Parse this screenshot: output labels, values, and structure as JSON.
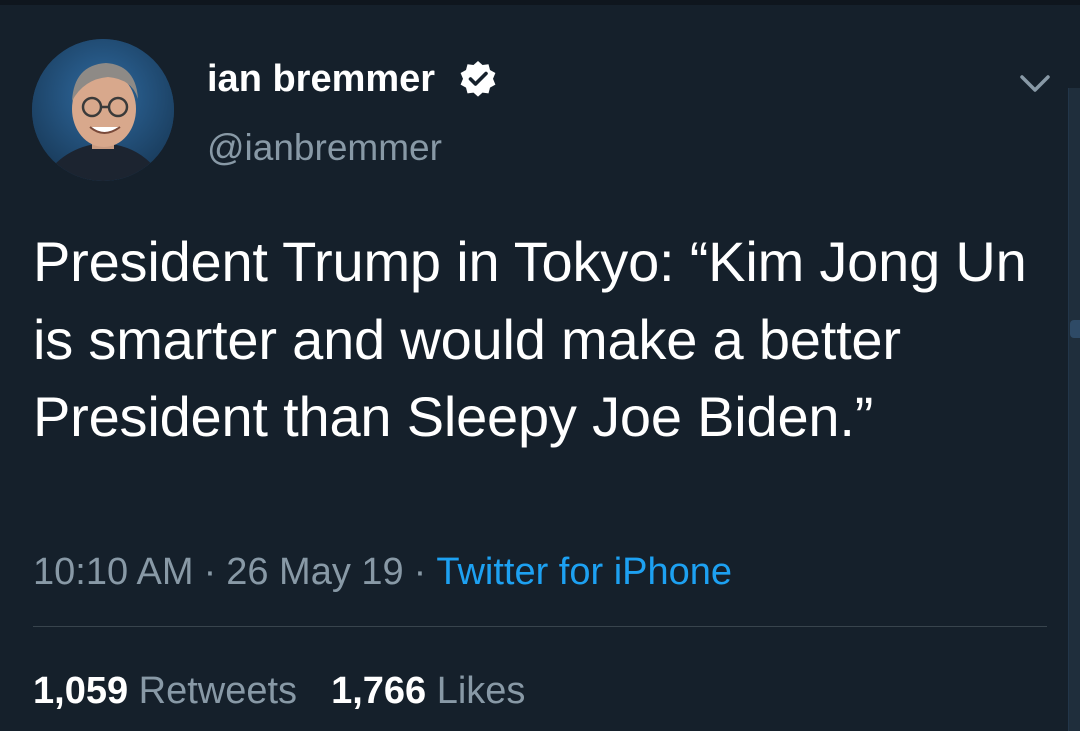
{
  "user": {
    "display_name": "ian bremmer",
    "handle": "@ianbremmer",
    "verified": true,
    "avatar_icon": "profile-photo"
  },
  "tweet": {
    "text": "President Trump in Tokyo: “Kim Jong Un is smarter and would make a better President than Sleepy Joe Biden.”",
    "time": "10:10 AM",
    "date": "26 May 19",
    "separator": "·",
    "source": "Twitter for iPhone"
  },
  "stats": {
    "retweets_count": "1,059",
    "retweets_label": "Retweets",
    "likes_count": "1,766",
    "likes_label": "Likes"
  },
  "colors": {
    "background": "#15202b",
    "text": "#ffffff",
    "secondary": "#8899a6",
    "link": "#1da1f2"
  },
  "icons": {
    "verified": "verified-badge-icon",
    "menu": "chevron-down-icon"
  }
}
